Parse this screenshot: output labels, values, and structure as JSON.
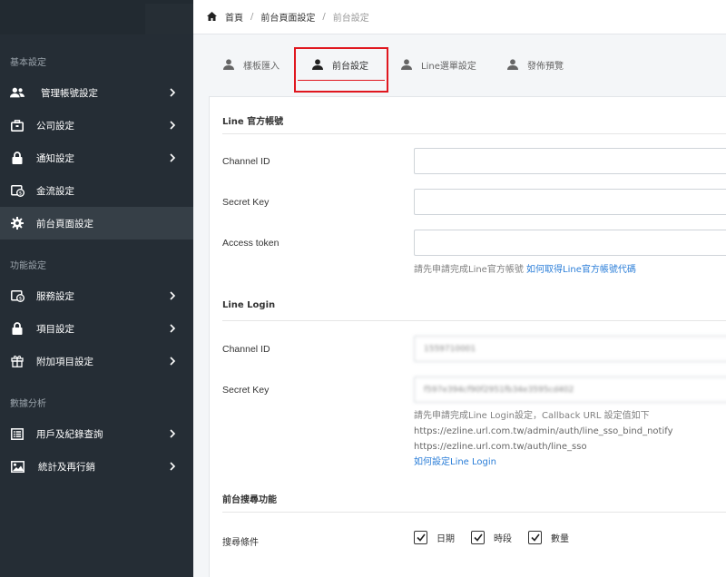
{
  "colors": {
    "sidebar_bg": "#252d35",
    "active_item_bg": "#363f47",
    "accent_link": "#2b7ed8",
    "highlight_red": "#e0171f"
  },
  "sidebar": {
    "sections": [
      {
        "title": "基本設定"
      },
      {
        "title": "功能設定"
      },
      {
        "title": "數據分析"
      }
    ],
    "items": [
      {
        "label": "管理帳號設定",
        "icon": "users-icon",
        "has_chevron": true
      },
      {
        "label": "公司設定",
        "icon": "briefcase-icon",
        "has_chevron": true
      },
      {
        "label": "通知設定",
        "icon": "lock-icon",
        "has_chevron": true
      },
      {
        "label": "金流設定",
        "icon": "money-icon",
        "has_chevron": false
      },
      {
        "label": "前台頁面設定",
        "icon": "gear-icon",
        "has_chevron": false,
        "active": true
      },
      {
        "label": "服務設定",
        "icon": "money-icon",
        "has_chevron": true
      },
      {
        "label": "項目設定",
        "icon": "lock-icon",
        "has_chevron": true
      },
      {
        "label": "附加項目設定",
        "icon": "gift-icon",
        "has_chevron": true
      },
      {
        "label": "用戶及紀錄查詢",
        "icon": "list-icon",
        "has_chevron": true
      },
      {
        "label": "統計及再行銷",
        "icon": "image-icon",
        "has_chevron": true
      }
    ]
  },
  "breadcrumb": {
    "home": "首頁",
    "parent": "前台頁面設定",
    "current": "前台設定"
  },
  "tabs": [
    {
      "label": "樣板匯入",
      "icon": "user-icon"
    },
    {
      "label": "前台設定",
      "icon": "user-icon",
      "active": true
    },
    {
      "label": "Line選單設定",
      "icon": "user-icon"
    },
    {
      "label": "發佈預覽",
      "icon": "user-icon"
    }
  ],
  "form": {
    "line_official": {
      "heading": "Line 官方帳號",
      "channel_id_label": "Channel ID",
      "channel_id_value": "",
      "secret_key_label": "Secret Key",
      "secret_key_value": "",
      "access_token_label": "Access token",
      "access_token_value": "",
      "help_text": "請先申請完成Line官方帳號",
      "help_link": "如何取得Line官方帳號代碼"
    },
    "line_login": {
      "heading": "Line Login",
      "channel_id_label": "Channel ID",
      "channel_id_value": "1559710001",
      "secret_key_label": "Secret Key",
      "secret_key_value": "f597e394cf90f2951fb34e3595cd402",
      "help_line1": "請先申請完成Line Login設定，Callback URL 設定值如下",
      "help_line2": "https://ezline.url.com.tw/admin/auth/line_sso_bind_notify",
      "help_line3": "https://ezline.url.com.tw/auth/line_sso",
      "help_link": "如何設定Line Login"
    },
    "search": {
      "heading": "前台搜尋功能",
      "condition_label": "搜尋條件",
      "options": [
        {
          "label": "日期",
          "checked": true
        },
        {
          "label": "時段",
          "checked": true
        },
        {
          "label": "數量",
          "checked": true
        }
      ]
    }
  }
}
